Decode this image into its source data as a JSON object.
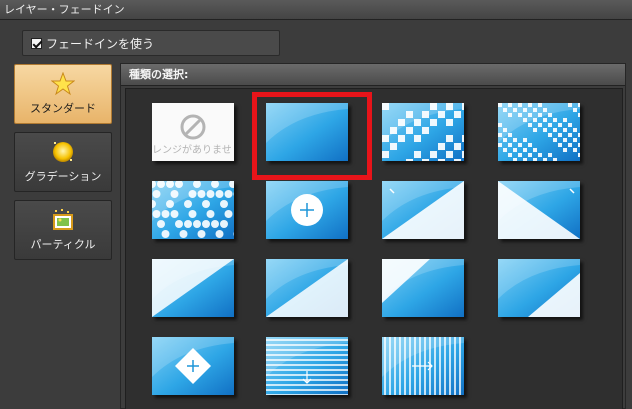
{
  "window": {
    "title": "レイヤー・フェードイン"
  },
  "fade_in_checkbox": {
    "label": "フェードインを使う",
    "checked": true
  },
  "sidebar": {
    "items": [
      {
        "label": "スタンダード",
        "icon": "star-icon",
        "active": true
      },
      {
        "label": "グラデーション",
        "icon": "gradient-circle-icon",
        "active": false
      },
      {
        "label": "パーティクル",
        "icon": "particle-image-icon",
        "active": false
      }
    ]
  },
  "type_panel": {
    "header": "種類の選択:",
    "none_text": "レンジがありませ",
    "selected_index": 1,
    "thumbnails": [
      {
        "name": "none",
        "style": "none"
      },
      {
        "name": "fade-plain",
        "style": "plain"
      },
      {
        "name": "blocks-large",
        "style": "blocks"
      },
      {
        "name": "blocks-small",
        "style": "blocks-small"
      },
      {
        "name": "hexagons",
        "style": "hex"
      },
      {
        "name": "circle-center",
        "style": "circle"
      },
      {
        "name": "wipe-top-left",
        "style": "wipe-tl"
      },
      {
        "name": "wipe-bottom-left",
        "style": "wipe-bl"
      },
      {
        "name": "wipe-top-right",
        "style": "wipe-tr"
      },
      {
        "name": "wipe-bottom-right",
        "style": "wipe-br"
      },
      {
        "name": "wipe-diagonal-down",
        "style": "wipe-dd"
      },
      {
        "name": "wipe-diagonal-up",
        "style": "wipe-du"
      },
      {
        "name": "diamond-center",
        "style": "diamond"
      },
      {
        "name": "lines-horizontal",
        "style": "hlines"
      },
      {
        "name": "lines-vertical",
        "style": "vlines"
      }
    ]
  },
  "colors": {
    "selection": "#e8141a",
    "thumb_blue": "#1e95d8",
    "active_tab": "#f0c27f"
  }
}
